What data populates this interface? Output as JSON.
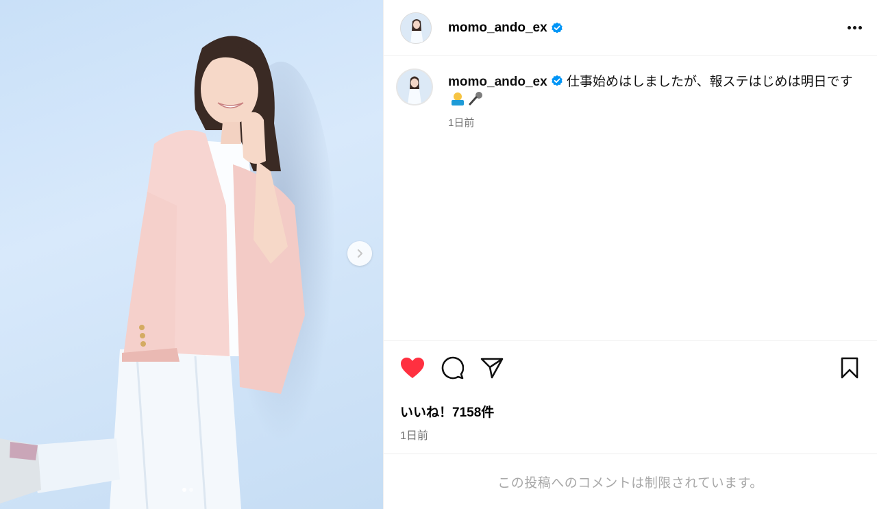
{
  "post": {
    "username": "momo_ando_ex",
    "verified": true,
    "caption": "仕事始めはしましたが、報ステはじめは明日です",
    "caption_emojis": [
      "person-raising-hand-emoji",
      "microphone-emoji"
    ],
    "caption_time": "1日前",
    "likes_text": "いいね！7158件",
    "date_text": "1日前",
    "comments_notice": "この投稿へのコメントは制限されています。",
    "carousel": {
      "current": 1,
      "total": 2
    }
  },
  "icons": {
    "verified": "verified-badge-icon",
    "more": "more-options-icon",
    "like": "heart-icon",
    "comment": "comment-icon",
    "share": "share-icon",
    "save": "bookmark-icon",
    "next": "chevron-right-icon"
  },
  "colors": {
    "verified_blue": "#0095f6",
    "liked_red": "#ff3040",
    "muted_text": "#737373",
    "disabled_text": "#a8a8a8",
    "divider": "#efefef",
    "photo_background": "#c9e0f8"
  }
}
